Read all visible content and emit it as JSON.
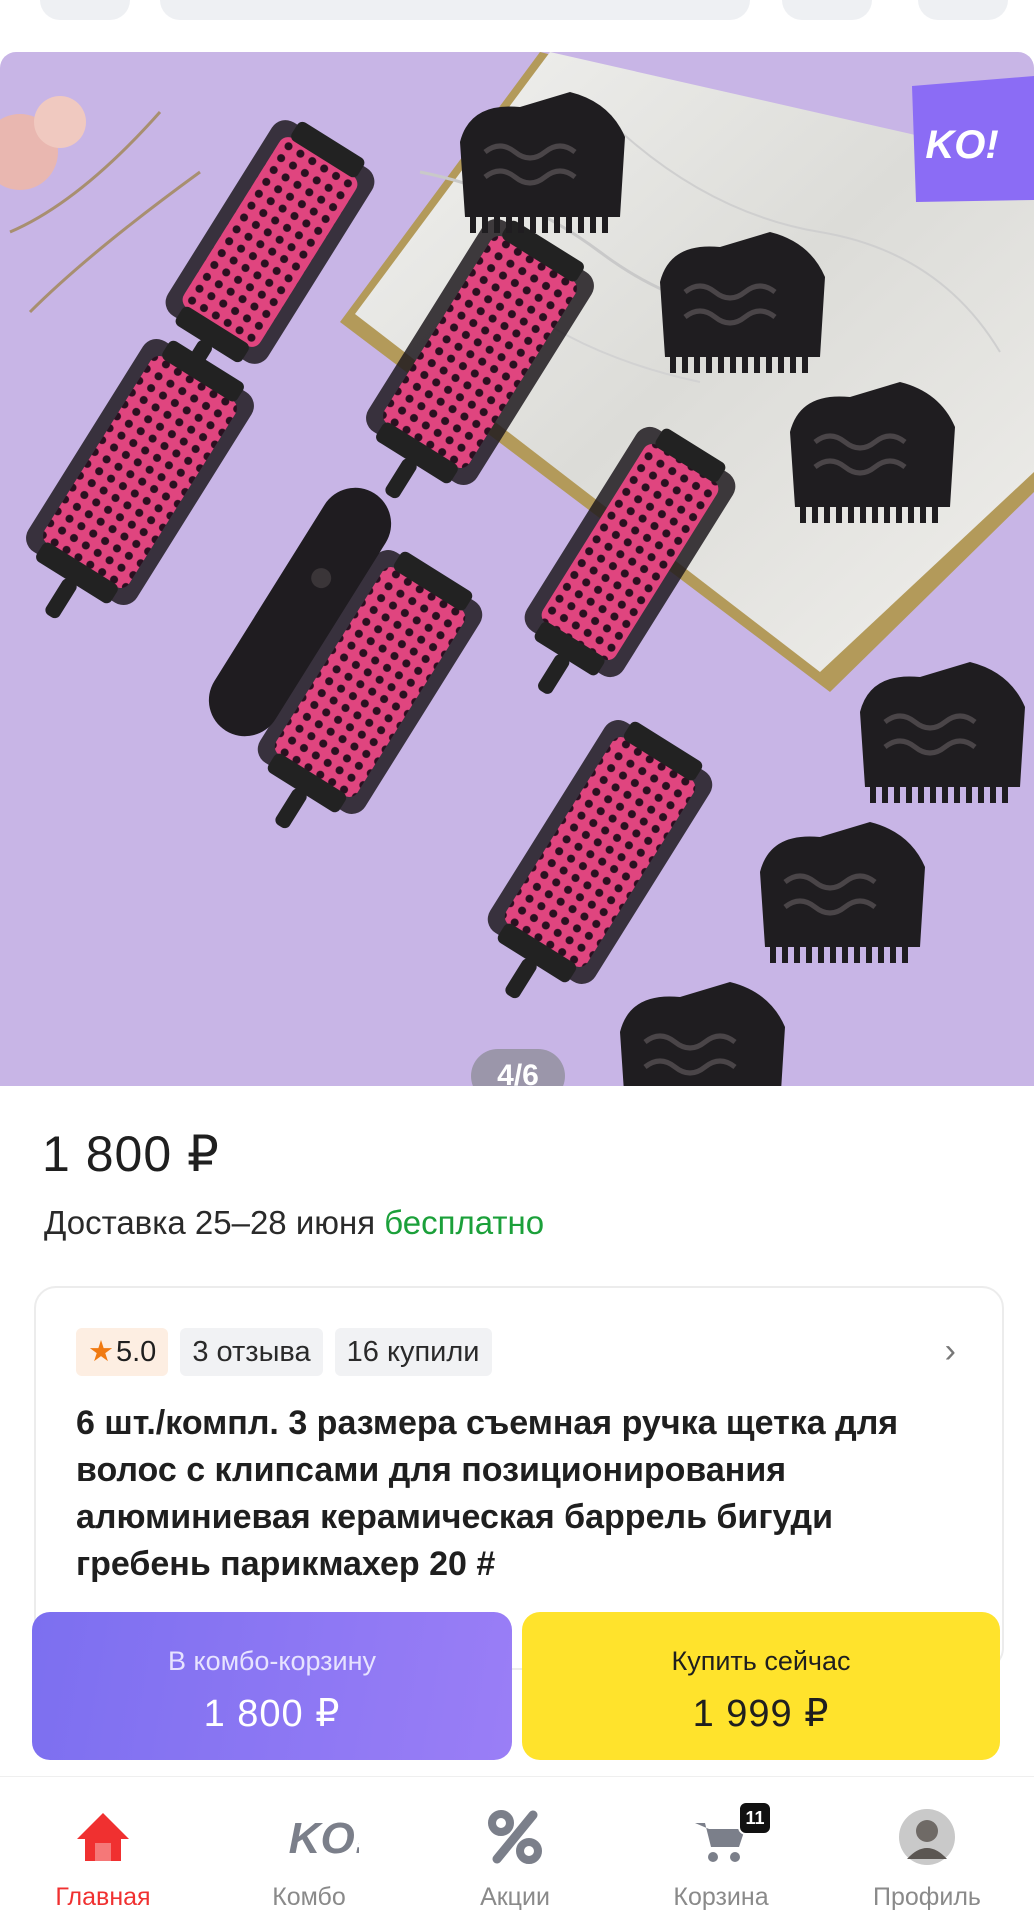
{
  "gallery": {
    "counter": "4/6",
    "brand_badge": "KO!"
  },
  "product": {
    "price": "1 800 ₽",
    "delivery_text": "Доставка 25–28 июня",
    "delivery_free": "бесплатно",
    "rating": "5.0",
    "reviews": "3 отзыва",
    "purchases": "16 купили",
    "title": "6 шт./компл. 3 размера съемная ручка щетка для волос с клипсами для позиционирования алюминиевая керамическая баррель бигуди гребень парикмахер 20 #"
  },
  "actions": {
    "combo_label": "В комбо-корзину",
    "combo_price": "1 800 ₽",
    "buy_label": "Купить сейчас",
    "buy_price": "1 999 ₽"
  },
  "nav": {
    "home": "Главная",
    "combo": "Комбо",
    "combo_logo": "KO!",
    "promo": "Акции",
    "cart": "Корзина",
    "cart_count": "11",
    "profile": "Профиль"
  },
  "colors": {
    "accent_red": "#f03030",
    "free_green": "#1ba03a",
    "combo_purple": "#8473f2",
    "buy_yellow": "#ffe32c",
    "brush_pink": "#e0457f",
    "background_lilac": "#c8b5e6"
  },
  "icons": [
    "home-icon",
    "ko-logo-icon",
    "percent-icon",
    "cart-icon",
    "avatar",
    "chevron-right-icon",
    "star-icon"
  ]
}
